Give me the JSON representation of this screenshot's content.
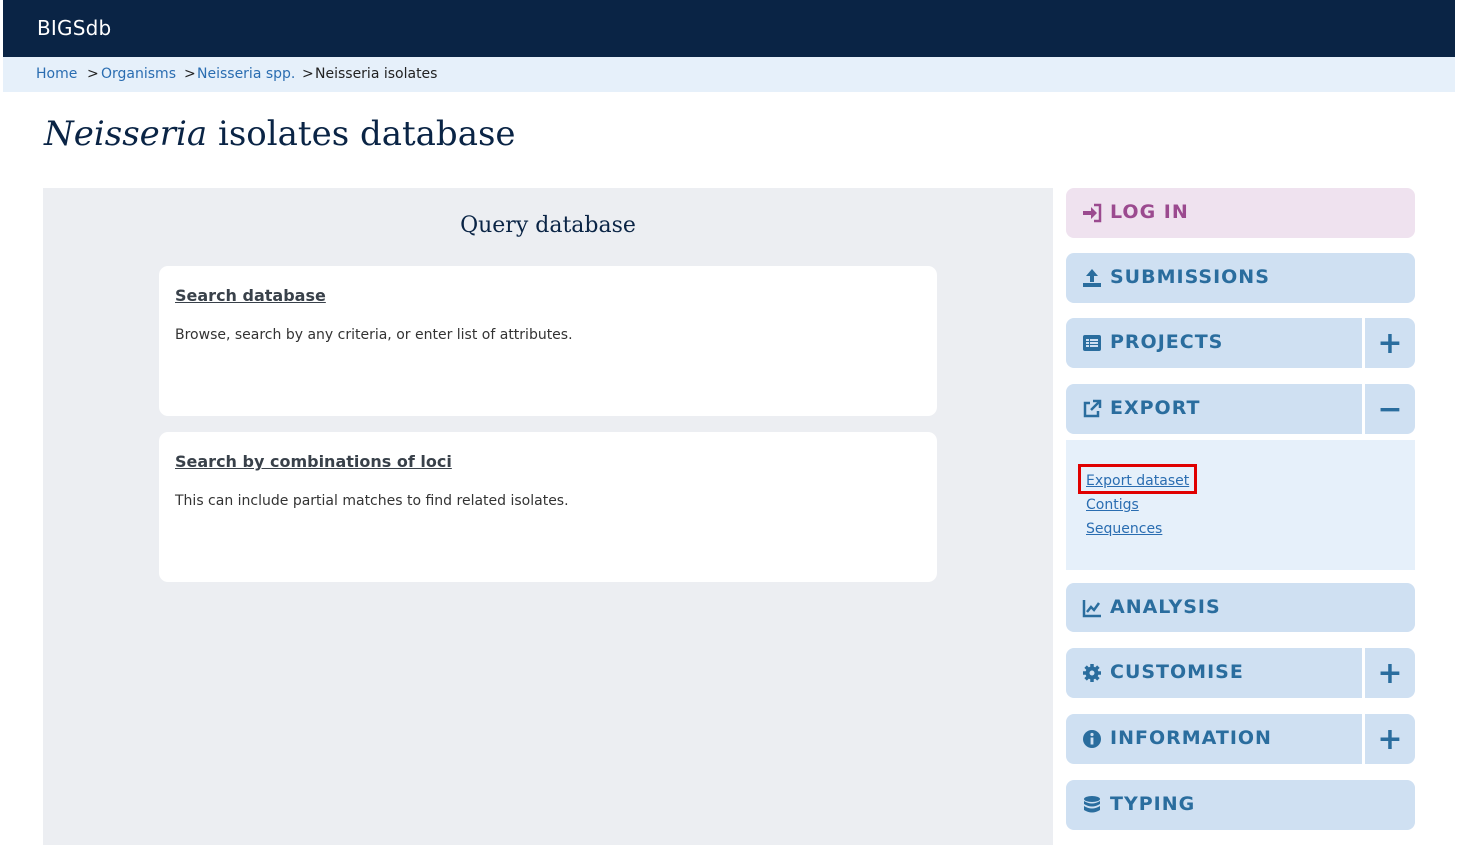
{
  "header": {
    "brand": "BIGSdb"
  },
  "breadcrumb": {
    "items": [
      "Home",
      "Organisms",
      "Neisseria spp.",
      "Neisseria isolates"
    ],
    "separator": ">"
  },
  "page": {
    "title_italic": "Neisseria",
    "title_rest": "isolates database"
  },
  "main": {
    "heading": "Query database",
    "cards": [
      {
        "title": "Search database",
        "description": "Browse, search by any criteria, or enter list of attributes."
      },
      {
        "title": "Search by combinations of loci",
        "description": "This can include partial matches to find related isolates."
      }
    ]
  },
  "sidebar": {
    "items": [
      {
        "label": "LOG IN",
        "icon": "sign-in-icon"
      },
      {
        "label": "SUBMISSIONS",
        "icon": "upload-icon"
      },
      {
        "label": "PROJECTS",
        "icon": "list-icon",
        "toggle": "+"
      },
      {
        "label": "EXPORT",
        "icon": "external-link-icon",
        "toggle": "−"
      },
      {
        "label": "ANALYSIS",
        "icon": "chart-line-icon"
      },
      {
        "label": "CUSTOMISE",
        "icon": "gear-icon",
        "toggle": "+"
      },
      {
        "label": "INFORMATION",
        "icon": "info-circle-icon",
        "toggle": "+"
      },
      {
        "label": "TYPING",
        "icon": "database-icon"
      }
    ],
    "export_links": [
      "Export dataset",
      "Contigs",
      "Sequences"
    ]
  },
  "colors": {
    "topbar": "#0a2445",
    "breadcrumb_bg": "#e6f0fa",
    "sidebar_button": "#cfe0f2",
    "login_button": "#efe2ef",
    "highlight": "#e00000"
  }
}
